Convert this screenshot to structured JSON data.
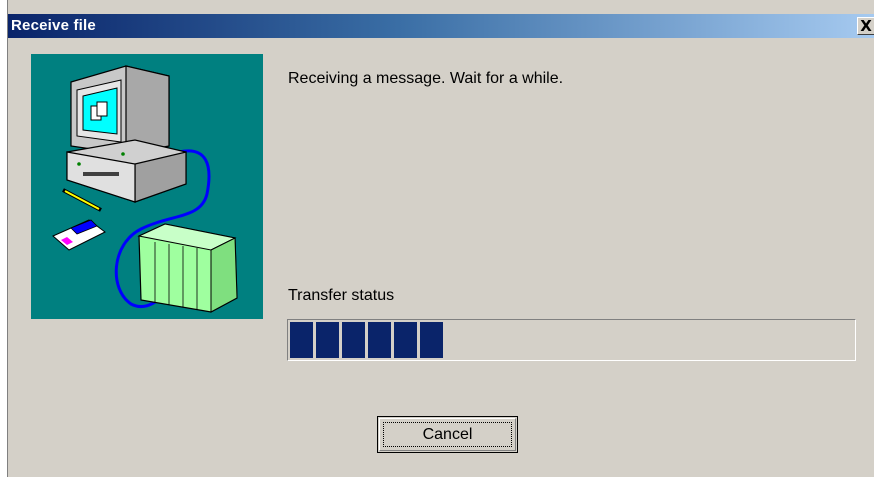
{
  "window": {
    "title": "Receive file",
    "close_glyph": "X"
  },
  "illustration": {
    "icon": "computer-plc-transfer-illustration",
    "background": "#008080"
  },
  "message": "Receiving a message. Wait for a while.",
  "transfer": {
    "label": "Transfer status",
    "progress_blocks_filled": 6,
    "bar_color": "#0a246a"
  },
  "buttons": {
    "cancel": "Cancel"
  }
}
